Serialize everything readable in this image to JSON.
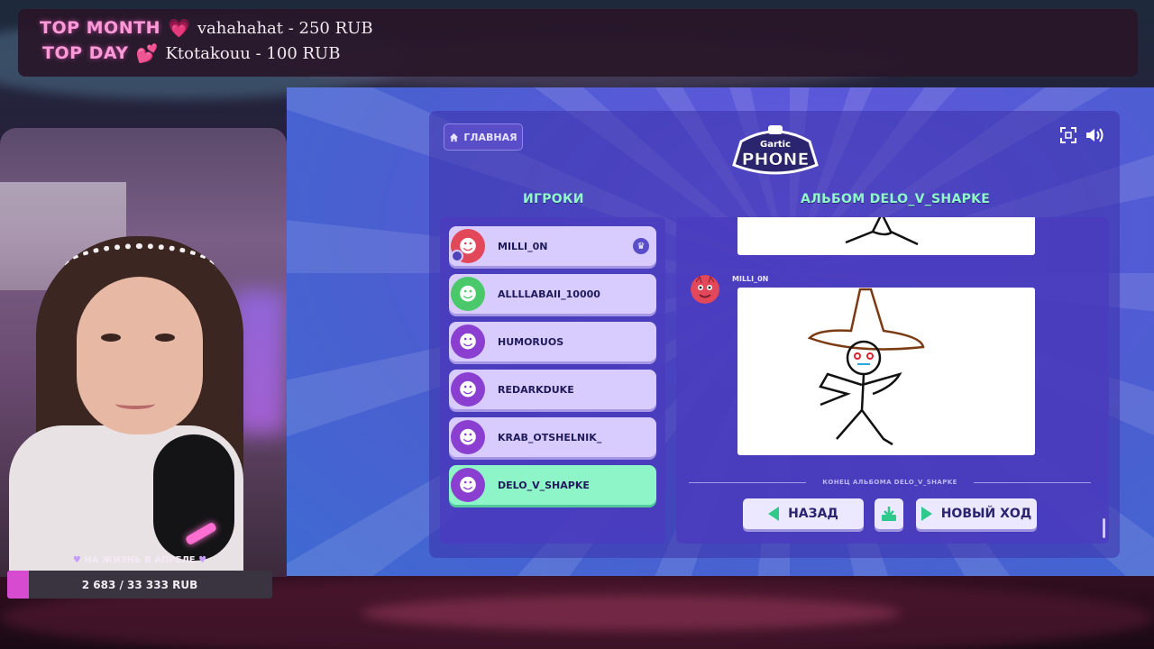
{
  "stream_overlay": {
    "top_month": {
      "label": "TOP MONTH",
      "heart": "💗",
      "value": "vahahahat - 250 RUB"
    },
    "top_day": {
      "label": "TOP DAY",
      "heart": "💕",
      "value": "Ktotakouu - 100 RUB"
    },
    "goal": {
      "label": "НА ЖИЗНЬ В АПРЕЛЕ",
      "progress_text": "2 683 / 33 333 RUB",
      "progress_fraction": 0.08,
      "fill_color": "#d64bd0"
    }
  },
  "game": {
    "home_button": "ГЛАВНАЯ",
    "logo_small": "Gartic",
    "logo_big": "PHONE",
    "players_title": "ИГРОКИ",
    "album_title": "АЛЬБОМ DELO_V_SHAPKE",
    "players": [
      {
        "name": "MILLI_0N",
        "avatar_color": "#e2475a",
        "avatar_glyph": "☻",
        "host": true,
        "crown": "♛",
        "active": false
      },
      {
        "name": "ALLLLABAII_10000",
        "avatar_color": "#49c96a",
        "avatar_glyph": "☻",
        "host": false,
        "active": false
      },
      {
        "name": "HUMORUOS",
        "avatar_color": "#8a3fd0",
        "avatar_glyph": "☻",
        "host": false,
        "active": false
      },
      {
        "name": "REDARKDUKE",
        "avatar_color": "#8a3fd0",
        "avatar_glyph": "☻",
        "host": false,
        "active": false
      },
      {
        "name": "KRAB_OTSHELNIK_",
        "avatar_color": "#8a3fd0",
        "avatar_glyph": "☻",
        "host": false,
        "active": false
      },
      {
        "name": "DELO_V_SHAPKE",
        "avatar_color": "#8a3fd0",
        "avatar_glyph": "☻",
        "host": false,
        "active": true
      }
    ],
    "album": {
      "author": "MILLI_0N",
      "end_text": "КОНЕЦ АЛЬБОМА DELO_V_SHAPKE",
      "back_button": "НАЗАД",
      "new_turn_button": "НОВЫЙ ХОД"
    },
    "accent_green": "#8ff7c9",
    "panel_color": "#4a3cbe"
  }
}
